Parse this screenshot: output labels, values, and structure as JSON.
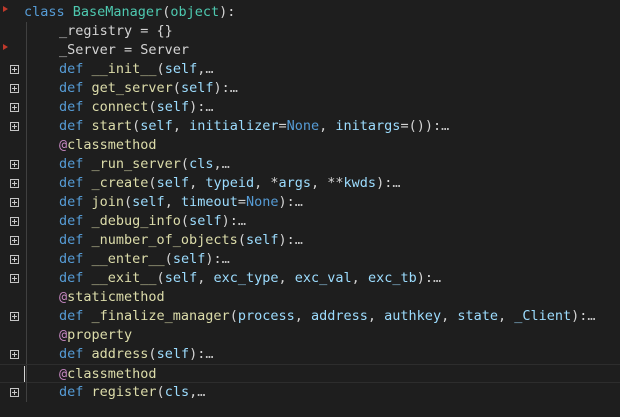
{
  "colors": {
    "background": "#1e1e1e",
    "keyword": "#569cd6",
    "class_name": "#4ec9b0",
    "function_name": "#dcdcaa",
    "parameter": "#9cdcfe",
    "decorator": "#c586c0",
    "breakpoint": "#c0392b"
  },
  "lines": [
    {
      "id": "class-def",
      "tokens": [
        [
          "kw",
          "class "
        ],
        [
          "cls",
          "BaseManager"
        ],
        [
          "txt",
          "("
        ],
        [
          "cls",
          "object"
        ],
        [
          "txt",
          "):"
        ]
      ]
    },
    {
      "id": "registry",
      "tokens": [
        [
          "txt",
          "_registry = {}"
        ]
      ]
    },
    {
      "id": "server",
      "tokens": [
        [
          "txt",
          "_Server = Server"
        ]
      ]
    },
    {
      "id": "def-init",
      "tokens": [
        [
          "kw",
          "def "
        ],
        [
          "fn",
          "__init__"
        ],
        [
          "txt",
          "("
        ],
        [
          "par",
          "self"
        ],
        [
          "txt",
          ","
        ],
        [
          "ell",
          "…"
        ]
      ]
    },
    {
      "id": "def-get-server",
      "tokens": [
        [
          "kw",
          "def "
        ],
        [
          "fn",
          "get_server"
        ],
        [
          "txt",
          "("
        ],
        [
          "par",
          "self"
        ],
        [
          "txt",
          "):"
        ],
        [
          "ell",
          "…"
        ]
      ]
    },
    {
      "id": "def-connect",
      "tokens": [
        [
          "kw",
          "def "
        ],
        [
          "fn",
          "connect"
        ],
        [
          "txt",
          "("
        ],
        [
          "par",
          "self"
        ],
        [
          "txt",
          "):"
        ],
        [
          "ell",
          "…"
        ]
      ]
    },
    {
      "id": "def-start",
      "tokens": [
        [
          "kw",
          "def "
        ],
        [
          "fn",
          "start"
        ],
        [
          "txt",
          "("
        ],
        [
          "par",
          "self"
        ],
        [
          "txt",
          ", "
        ],
        [
          "par",
          "initializer"
        ],
        [
          "txt",
          "="
        ],
        [
          "const",
          "None"
        ],
        [
          "txt",
          ", "
        ],
        [
          "par",
          "initargs"
        ],
        [
          "txt",
          "=()):"
        ],
        [
          "ell",
          "…"
        ]
      ]
    },
    {
      "id": "dec-classmethod-1",
      "tokens": [
        [
          "dec",
          "@"
        ],
        [
          "fn",
          "classmethod"
        ]
      ]
    },
    {
      "id": "def-run-server",
      "tokens": [
        [
          "kw",
          "def "
        ],
        [
          "fn",
          "_run_server"
        ],
        [
          "txt",
          "("
        ],
        [
          "par",
          "cls"
        ],
        [
          "txt",
          ","
        ],
        [
          "ell",
          "…"
        ]
      ]
    },
    {
      "id": "def-create",
      "tokens": [
        [
          "kw",
          "def "
        ],
        [
          "fn",
          "_create"
        ],
        [
          "txt",
          "("
        ],
        [
          "par",
          "self"
        ],
        [
          "txt",
          ", "
        ],
        [
          "par",
          "typeid"
        ],
        [
          "txt",
          ", *"
        ],
        [
          "par",
          "args"
        ],
        [
          "txt",
          ", **"
        ],
        [
          "par",
          "kwds"
        ],
        [
          "txt",
          "):"
        ],
        [
          "ell",
          "…"
        ]
      ]
    },
    {
      "id": "def-join",
      "tokens": [
        [
          "kw",
          "def "
        ],
        [
          "fn",
          "join"
        ],
        [
          "txt",
          "("
        ],
        [
          "par",
          "self"
        ],
        [
          "txt",
          ", "
        ],
        [
          "par",
          "timeout"
        ],
        [
          "txt",
          "="
        ],
        [
          "const",
          "None"
        ],
        [
          "txt",
          "):"
        ],
        [
          "ell",
          "…"
        ]
      ]
    },
    {
      "id": "def-debug-info",
      "tokens": [
        [
          "kw",
          "def "
        ],
        [
          "fn",
          "_debug_info"
        ],
        [
          "txt",
          "("
        ],
        [
          "par",
          "self"
        ],
        [
          "txt",
          "):"
        ],
        [
          "ell",
          "…"
        ]
      ]
    },
    {
      "id": "def-number-of-objects",
      "tokens": [
        [
          "kw",
          "def "
        ],
        [
          "fn",
          "_number_of_objects"
        ],
        [
          "txt",
          "("
        ],
        [
          "par",
          "self"
        ],
        [
          "txt",
          "):"
        ],
        [
          "ell",
          "…"
        ]
      ]
    },
    {
      "id": "def-enter",
      "tokens": [
        [
          "kw",
          "def "
        ],
        [
          "fn",
          "__enter__"
        ],
        [
          "txt",
          "("
        ],
        [
          "par",
          "self"
        ],
        [
          "txt",
          "):"
        ],
        [
          "ell",
          "…"
        ]
      ]
    },
    {
      "id": "def-exit",
      "tokens": [
        [
          "kw",
          "def "
        ],
        [
          "fn",
          "__exit__"
        ],
        [
          "txt",
          "("
        ],
        [
          "par",
          "self"
        ],
        [
          "txt",
          ", "
        ],
        [
          "par",
          "exc_type"
        ],
        [
          "txt",
          ", "
        ],
        [
          "par",
          "exc_val"
        ],
        [
          "txt",
          ", "
        ],
        [
          "par",
          "exc_tb"
        ],
        [
          "txt",
          "):"
        ],
        [
          "ell",
          "…"
        ]
      ]
    },
    {
      "id": "dec-staticmethod",
      "tokens": [
        [
          "dec",
          "@"
        ],
        [
          "fn",
          "staticmethod"
        ]
      ]
    },
    {
      "id": "def-finalize-manager",
      "tokens": [
        [
          "kw",
          "def "
        ],
        [
          "fn",
          "_finalize_manager"
        ],
        [
          "txt",
          "("
        ],
        [
          "par",
          "process"
        ],
        [
          "txt",
          ", "
        ],
        [
          "par",
          "address"
        ],
        [
          "txt",
          ", "
        ],
        [
          "par",
          "authkey"
        ],
        [
          "txt",
          ", "
        ],
        [
          "par",
          "state"
        ],
        [
          "txt",
          ", "
        ],
        [
          "par",
          "_Client"
        ],
        [
          "txt",
          "):"
        ],
        [
          "ell",
          "…"
        ]
      ]
    },
    {
      "id": "dec-property",
      "tokens": [
        [
          "dec",
          "@"
        ],
        [
          "fn",
          "property"
        ]
      ]
    },
    {
      "id": "def-address",
      "tokens": [
        [
          "kw",
          "def "
        ],
        [
          "fn",
          "address"
        ],
        [
          "txt",
          "("
        ],
        [
          "par",
          "self"
        ],
        [
          "txt",
          "):"
        ],
        [
          "ell",
          "…"
        ]
      ]
    },
    {
      "id": "dec-classmethod-2",
      "tokens": [
        [
          "dec",
          "@"
        ],
        [
          "fn",
          "classmethod"
        ]
      ]
    },
    {
      "id": "def-register",
      "tokens": [
        [
          "kw",
          "def "
        ],
        [
          "fn",
          "register"
        ],
        [
          "txt",
          "("
        ],
        [
          "par",
          "cls"
        ],
        [
          "txt",
          ","
        ],
        [
          "ell",
          "…"
        ]
      ]
    }
  ]
}
